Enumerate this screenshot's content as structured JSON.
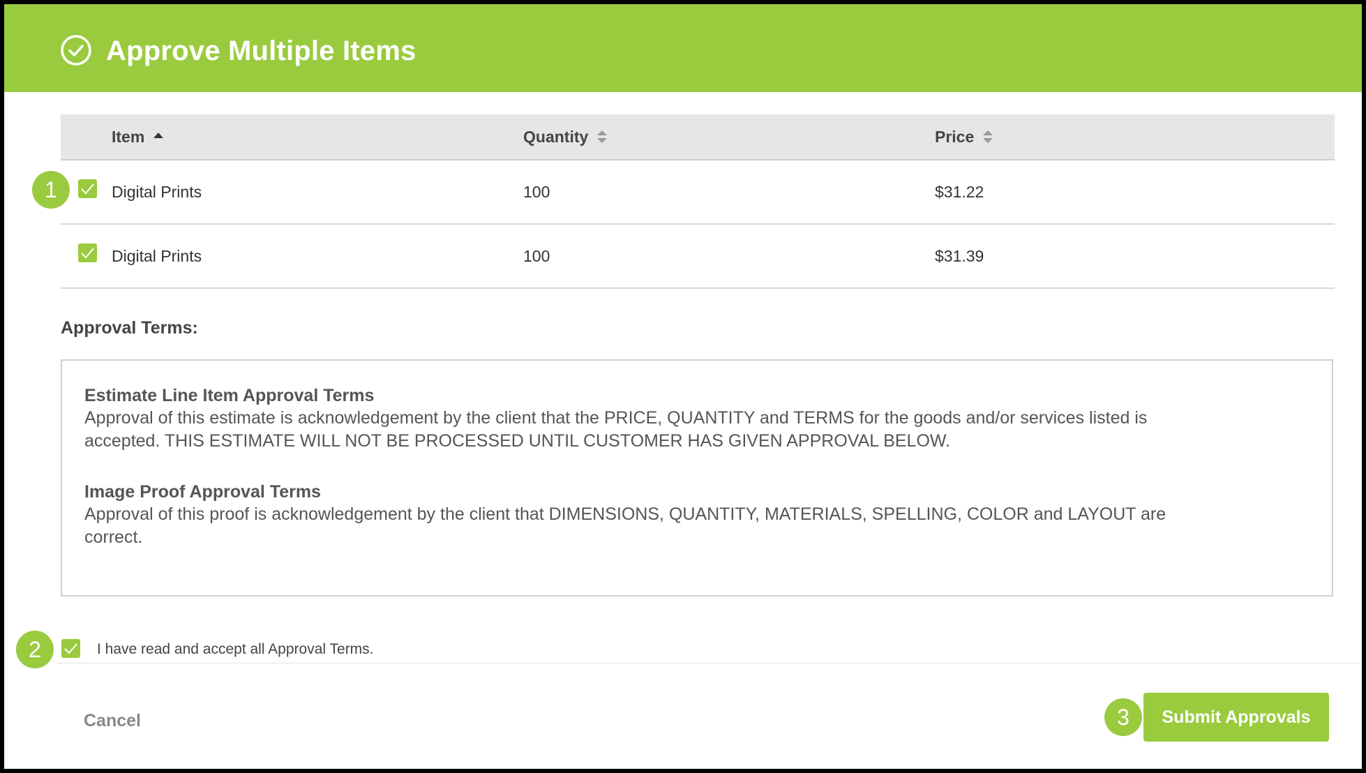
{
  "header": {
    "title": "Approve Multiple Items",
    "icon": "check-circle-icon",
    "color": "#9acb3f"
  },
  "table": {
    "columns": [
      {
        "label": "Item",
        "sort": "ascending"
      },
      {
        "label": "Quantity",
        "sort": "none"
      },
      {
        "label": "Price",
        "sort": "none"
      }
    ],
    "rows": [
      {
        "item": "Digital Prints",
        "quantity": "100",
        "price": "$31.22",
        "checked": true
      },
      {
        "item": "Digital Prints",
        "quantity": "100",
        "price": "$31.39",
        "checked": true
      }
    ]
  },
  "terms": {
    "label": "Approval Terms:",
    "blocks": [
      {
        "title": "Estimate Line Item Approval Terms",
        "line1": "Approval of this estimate is acknowledgement by the client that the PRICE, QUANTITY and TERMS for the goods and/or services listed is",
        "line2": "accepted. THIS ESTIMATE WILL NOT BE PROCESSED UNTIL CUSTOMER HAS GIVEN APPROVAL BELOW."
      },
      {
        "title": "Image Proof Approval Terms",
        "line1": "Approval of this proof is acknowledgement by the client that DIMENSIONS, QUANTITY, MATERIALS, SPELLING, COLOR and LAYOUT are",
        "line2": "correct."
      }
    ]
  },
  "accept": {
    "label": "I have read and accept all Approval Terms.",
    "checked": true
  },
  "footer": {
    "cancel_label": "Cancel",
    "submit_label": "Submit Approvals"
  },
  "callouts": [
    "1",
    "2",
    "3"
  ],
  "colors": {
    "accent": "#9acb3f",
    "header_bg": "#e6e6e6"
  }
}
